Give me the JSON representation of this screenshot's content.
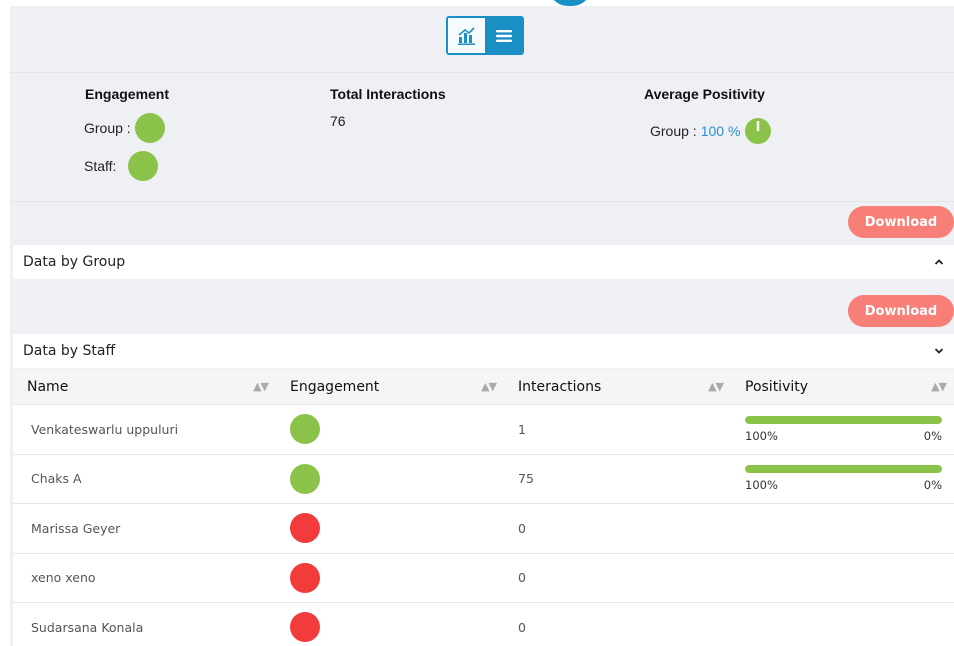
{
  "summary": {
    "engagement_label": "Engagement",
    "group_label": "Group :",
    "staff_label": "Staff:",
    "group_status": "green",
    "staff_status": "green",
    "total_interactions_label": "Total Interactions",
    "total_interactions_value": "76",
    "average_positivity_label": "Average Positivity",
    "avg_group_label": "Group :",
    "avg_group_value": "100 %",
    "avg_group_fraction": 1.0
  },
  "view_toggle": {
    "chart_icon": "bar-chart-icon",
    "list_icon": "list-icon",
    "active": "list"
  },
  "download_label": "Download",
  "sections": {
    "group_title": "Data by Group",
    "staff_title": "Data by Staff"
  },
  "table": {
    "headers": [
      "Name",
      "Engagement",
      "Interactions",
      "Positivity"
    ],
    "rows": [
      {
        "name": "Venkateswarlu uppuluri",
        "engagement": "green",
        "interactions": "1",
        "positivity": {
          "positive": "100%",
          "negative": "0%",
          "fraction": 1.0
        }
      },
      {
        "name": "Chaks A",
        "engagement": "green",
        "interactions": "75",
        "positivity": {
          "positive": "100%",
          "negative": "0%",
          "fraction": 1.0
        }
      },
      {
        "name": "Marissa Geyer",
        "engagement": "red",
        "interactions": "0",
        "positivity": null
      },
      {
        "name": "xeno xeno",
        "engagement": "red",
        "interactions": "0",
        "positivity": null
      },
      {
        "name": "Sudarsana Konala",
        "engagement": "red",
        "interactions": "0",
        "positivity": null
      }
    ]
  },
  "colors": {
    "accent": "#1a8fc4",
    "green": "#8bc34a",
    "red": "#f23b3b",
    "download": "#f77f77"
  }
}
